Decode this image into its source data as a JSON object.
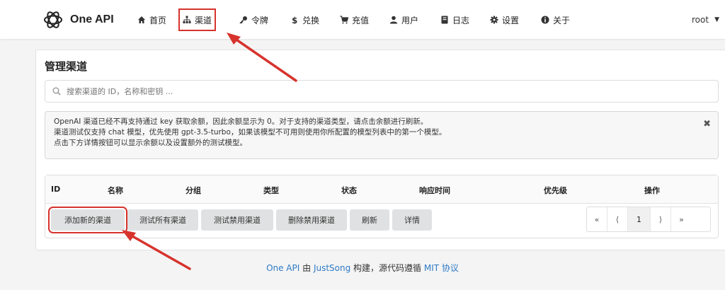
{
  "brand": {
    "name": "One API"
  },
  "nav": {
    "items": [
      {
        "label": "首页",
        "icon": "home-icon"
      },
      {
        "label": "渠道",
        "icon": "sitemap-icon"
      },
      {
        "label": "令牌",
        "icon": "key-icon"
      },
      {
        "label": "兑换",
        "icon": "dollar-icon"
      },
      {
        "label": "充值",
        "icon": "cart-icon"
      },
      {
        "label": "用户",
        "icon": "user-icon"
      },
      {
        "label": "日志",
        "icon": "book-icon"
      },
      {
        "label": "设置",
        "icon": "gear-icon"
      },
      {
        "label": "关于",
        "icon": "info-icon"
      }
    ],
    "user": "root"
  },
  "page": {
    "title": "管理渠道",
    "search_placeholder": "搜索渠道的 ID，名称和密钥 ..."
  },
  "notice": {
    "lines": [
      "OpenAI 渠道已经不再支持通过 key 获取余额，因此余额显示为 0。对于支持的渠道类型，请点击余额进行刷新。",
      "渠道测试仅支持 chat 模型，优先使用 gpt-3.5-turbo，如果该模型不可用则使用你所配置的模型列表中的第一个模型。",
      "点击下方详情按钮可以显示余额以及设置额外的测试模型。"
    ],
    "close": "✖"
  },
  "table": {
    "headers": [
      "ID",
      "名称",
      "分组",
      "类型",
      "状态",
      "响应时间",
      "优先级",
      "操作"
    ]
  },
  "actions": {
    "add": "添加新的渠道",
    "test_all": "测试所有渠道",
    "test_disabled": "测试禁用渠道",
    "delete_disabled": "删除禁用渠道",
    "refresh": "刷新",
    "details": "详情"
  },
  "pagination": {
    "first": "«",
    "prev": "⟨",
    "current": "1",
    "next": "⟩",
    "last": "»"
  },
  "footer": {
    "app": "One API",
    "by": " 由 ",
    "author": "JustSong",
    "middle": " 构建，源代码遵循 ",
    "license": "MIT 协议"
  },
  "colors": {
    "annotation_red": "#d7332d",
    "link_blue": "#2e7bc4",
    "button_grey": "#e0e1e2"
  }
}
